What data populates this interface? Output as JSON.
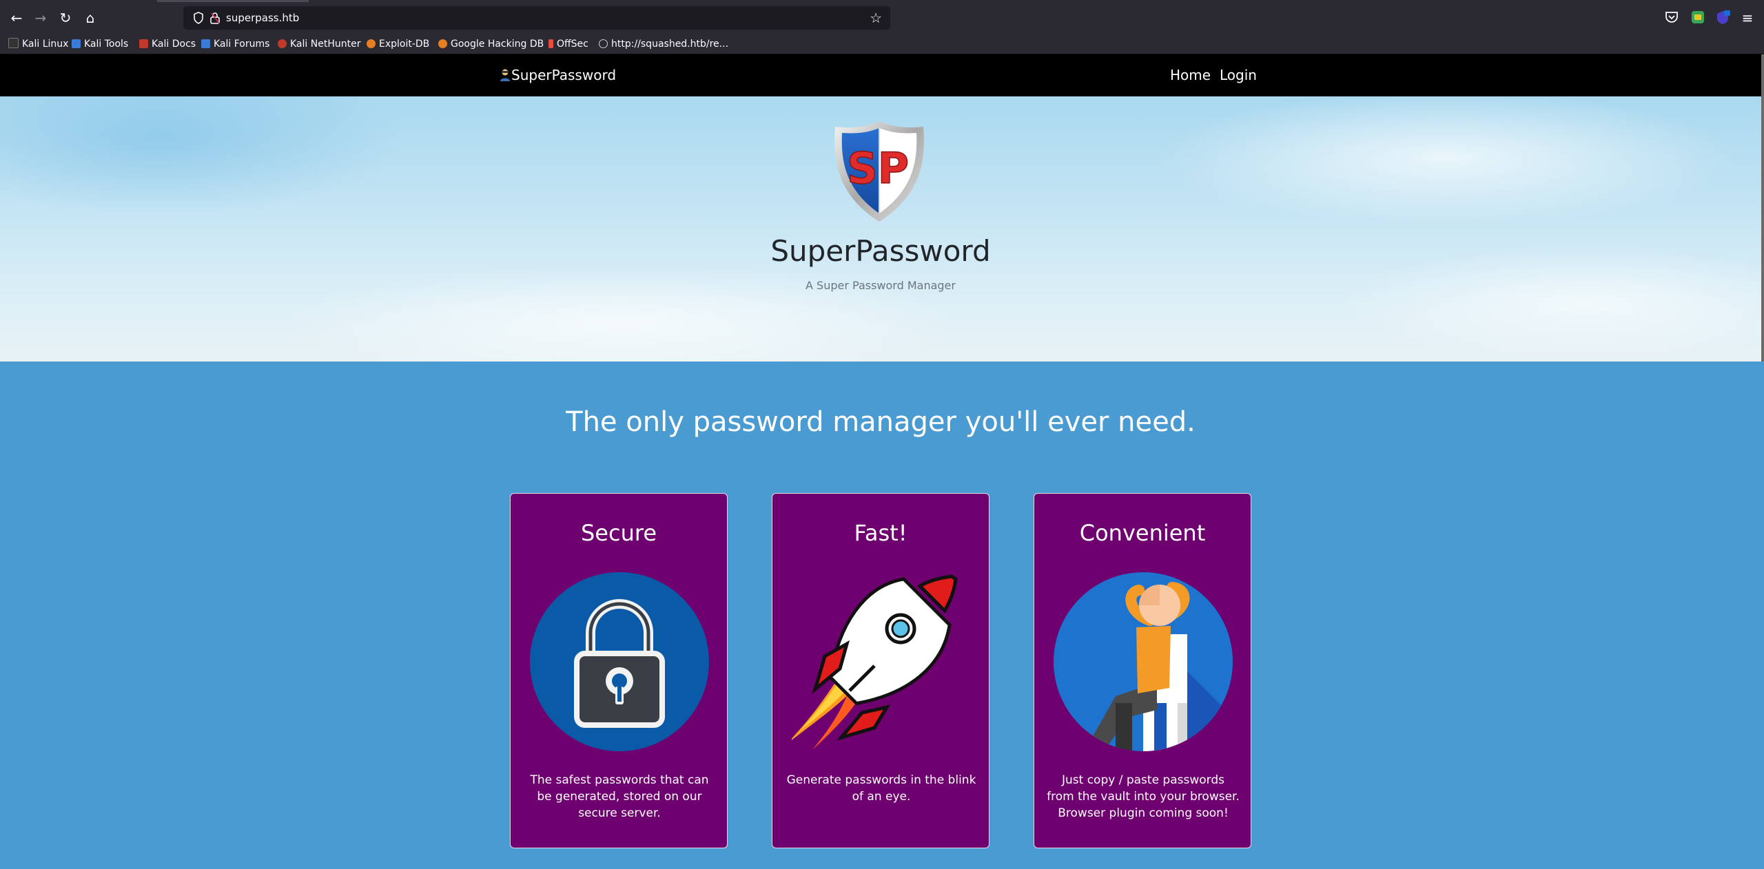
{
  "browser": {
    "url": "superpass.htb",
    "bookmarks": [
      {
        "label": "Kali Linux",
        "color": "#3a7bd5"
      },
      {
        "label": "Kali Tools",
        "color": "#3a7bd5"
      },
      {
        "label": "Kali Docs",
        "color": "#c0392b"
      },
      {
        "label": "Kali Forums",
        "color": "#3a7bd5"
      },
      {
        "label": "Kali NetHunter",
        "color": "#c0392b"
      },
      {
        "label": "Exploit-DB",
        "color": "#e67e22"
      },
      {
        "label": "Google Hacking DB",
        "color": "#e67e22"
      },
      {
        "label": "OffSec",
        "color": "#e74c3c"
      },
      {
        "label": "http://squashed.htb/re...",
        "color": "#cccccc"
      }
    ]
  },
  "nav": {
    "brand": "SuperPassword",
    "links": [
      "Home",
      "Login"
    ]
  },
  "hero": {
    "logo_text": "SP",
    "title": "SuperPassword",
    "subtitle": "A Super Password Manager"
  },
  "features": {
    "tagline": "The only password manager you'll ever need.",
    "cards": [
      {
        "title": "Secure",
        "text": "The safest passwords that can be generated, stored on our secure server.",
        "icon": "padlock-icon"
      },
      {
        "title": "Fast!",
        "text": "Generate passwords in the blink of an eye.",
        "icon": "rocket-icon"
      },
      {
        "title": "Convenient",
        "text": "Just copy / paste passwords from the vault into your browser. Browser plugin coming soon!",
        "icon": "relaxing-person-icon"
      }
    ]
  },
  "colors": {
    "page_bg": "#4b9bd3",
    "card_bg": "#6f006f",
    "navbar_bg": "#000000"
  }
}
